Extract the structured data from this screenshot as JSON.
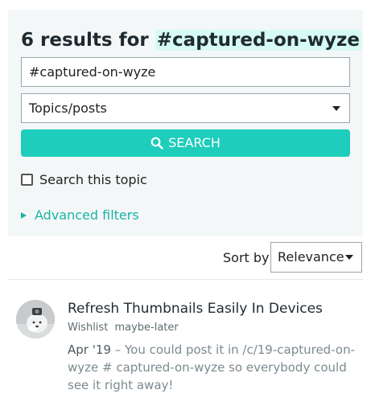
{
  "search": {
    "heading_prefix": "6 results for",
    "heading_term": "#captured-on-wyze",
    "input_value": "#captured-on-wyze",
    "type_selected": "Topics/posts",
    "button_label": "SEARCH",
    "checkbox_label": "Search this topic",
    "checkbox_checked": false,
    "advanced_label": "Advanced filters"
  },
  "sort": {
    "label": "Sort by",
    "selected": "Relevance"
  },
  "results": [
    {
      "title": "Refresh Thumbnails Easily In Devices",
      "category": "Wishlist",
      "tag": "maybe-later",
      "date": "Apr '19",
      "blurb": " – You could post it in /c/19-captured-on-wyze # captured-on-wyze so everybody could see it right away!"
    }
  ],
  "colors": {
    "accent": "#1ecdbb",
    "link": "#1ab4a4",
    "highlight": "#d6faf4",
    "panel": "#f4f7f8"
  }
}
